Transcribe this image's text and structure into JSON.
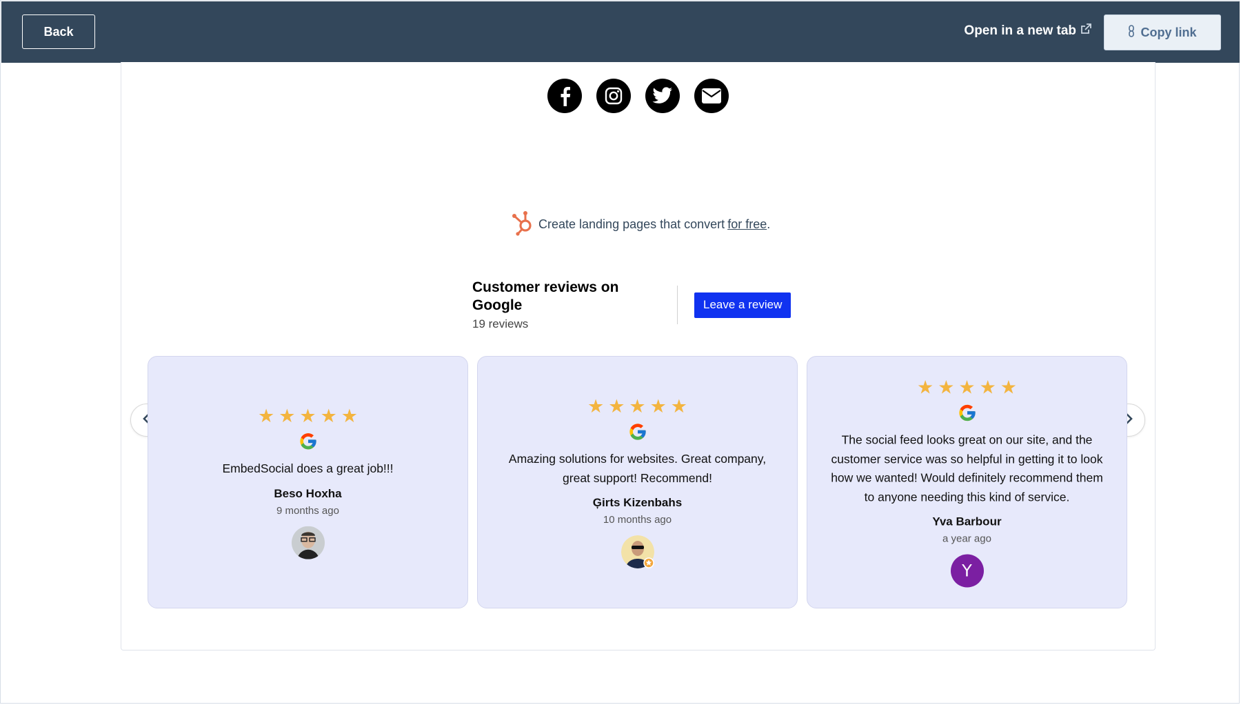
{
  "topbar": {
    "back_label": "Back",
    "open_tab_label": "Open in a new tab",
    "copy_link_label": "Copy link",
    "background": "#33475b"
  },
  "social_icons": [
    "facebook-icon",
    "instagram-icon",
    "twitter-icon",
    "email-icon"
  ],
  "hubspot": {
    "text": "Create landing pages that convert",
    "link": "for free",
    "suffix": ".",
    "brand_color": "#e8714c"
  },
  "reviews_header": {
    "title": "Customer reviews on Google",
    "count": "19 reviews",
    "button": "Leave a review",
    "button_color": "#1032f0"
  },
  "reviews": [
    {
      "stars": "★★★★★",
      "text": "EmbedSocial does a great job!!!",
      "name": "Beso Hoxha",
      "time": "9 months ago"
    },
    {
      "stars": "★★★★★",
      "text": "Amazing solutions for websites. Great company, great support! Recommend!",
      "name": "Ģirts Kizenbahs",
      "time": "10 months ago"
    },
    {
      "stars": "★★★★★",
      "text": "The social feed looks great on our site, and the customer service was so helpful in getting it to look how we wanted! Would definitely recommend them to anyone needing this kind of service.",
      "name": "Yva Barbour",
      "time": "a year ago",
      "avatar_letter": "Y"
    }
  ],
  "colors": {
    "star": "#f3b43f",
    "card_bg": "#e7e9fb",
    "avatar_purple": "#7b1fa2"
  }
}
